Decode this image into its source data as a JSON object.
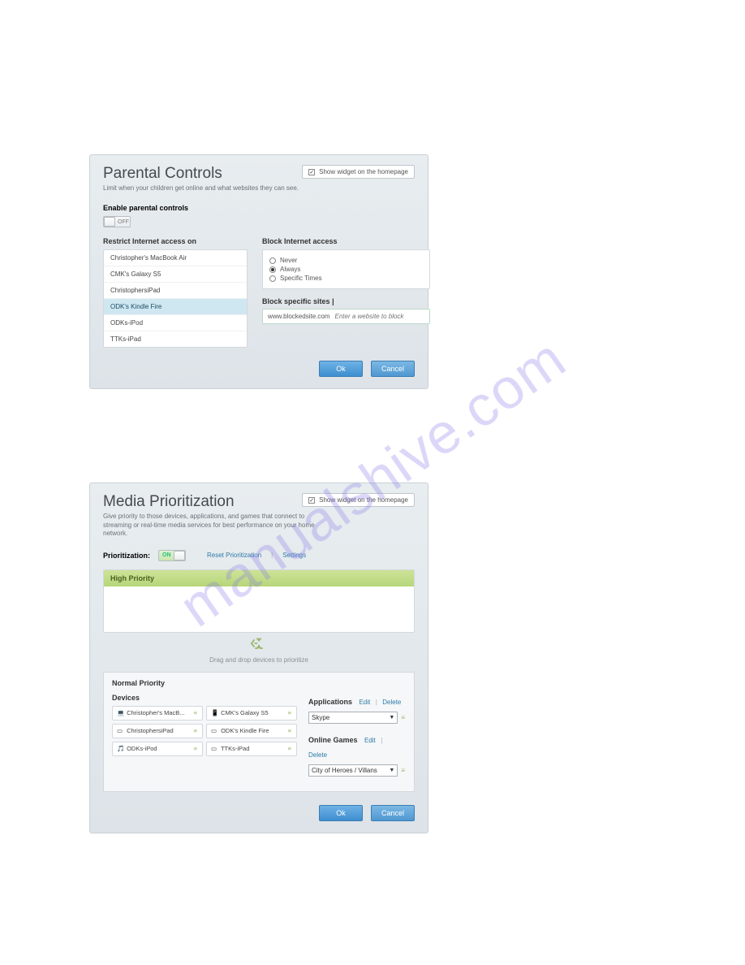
{
  "watermark": "manualshive.com",
  "parental": {
    "title": "Parental Controls",
    "subtitle": "Limit when your children get online and what websites they can see.",
    "widget_label": "Show widget on the homepage",
    "enable_label": "Enable parental controls",
    "toggle_state_label": "OFF",
    "restrict_label": "Restrict Internet access on",
    "devices": [
      "Christopher's MacBook Air",
      "CMK's Galaxy S5",
      "ChristophersiPad",
      "ODK's Kindle Fire",
      "ODKs-iPod",
      "TTKs-iPad"
    ],
    "selected_device_index": 3,
    "block_label": "Block Internet access",
    "block_options": [
      "Never",
      "Always",
      "Specific Times"
    ],
    "block_selected_index": 1,
    "block_sites_label": "Block specific sites",
    "block_sites_info": "|",
    "blocked_site": "www.blockedsite.com",
    "block_input_placeholder": "Enter a website to block",
    "ok": "Ok",
    "cancel": "Cancel"
  },
  "media": {
    "title": "Media Prioritization",
    "subtitle": "Give priority to those devices, applications, and games that connect to streaming or real-time media services for best performance on your home network.",
    "widget_label": "Show widget on the homepage",
    "prioritization_label": "Prioritization:",
    "toggle_state_label": "ON",
    "reset_link": "Reset Prioritization",
    "settings_link": "Settings",
    "high_priority_label": "High Priority",
    "drag_hint": "Drag and drop devices to prioritize",
    "normal_priority_label": "Normal Priority",
    "devices_label": "Devices",
    "devices": [
      "Christopher's MacB...",
      "CMK's Galaxy S5",
      "ChristophersiPad",
      "ODK's Kindle Fire",
      "ODKs-iPod",
      "TTKs-iPad"
    ],
    "applications_label": "Applications",
    "edit": "Edit",
    "delete": "Delete",
    "app_selected": "Skype",
    "games_label": "Online Games",
    "game_selected": "City of Heroes / Villans",
    "ok": "Ok",
    "cancel": "Cancel"
  }
}
